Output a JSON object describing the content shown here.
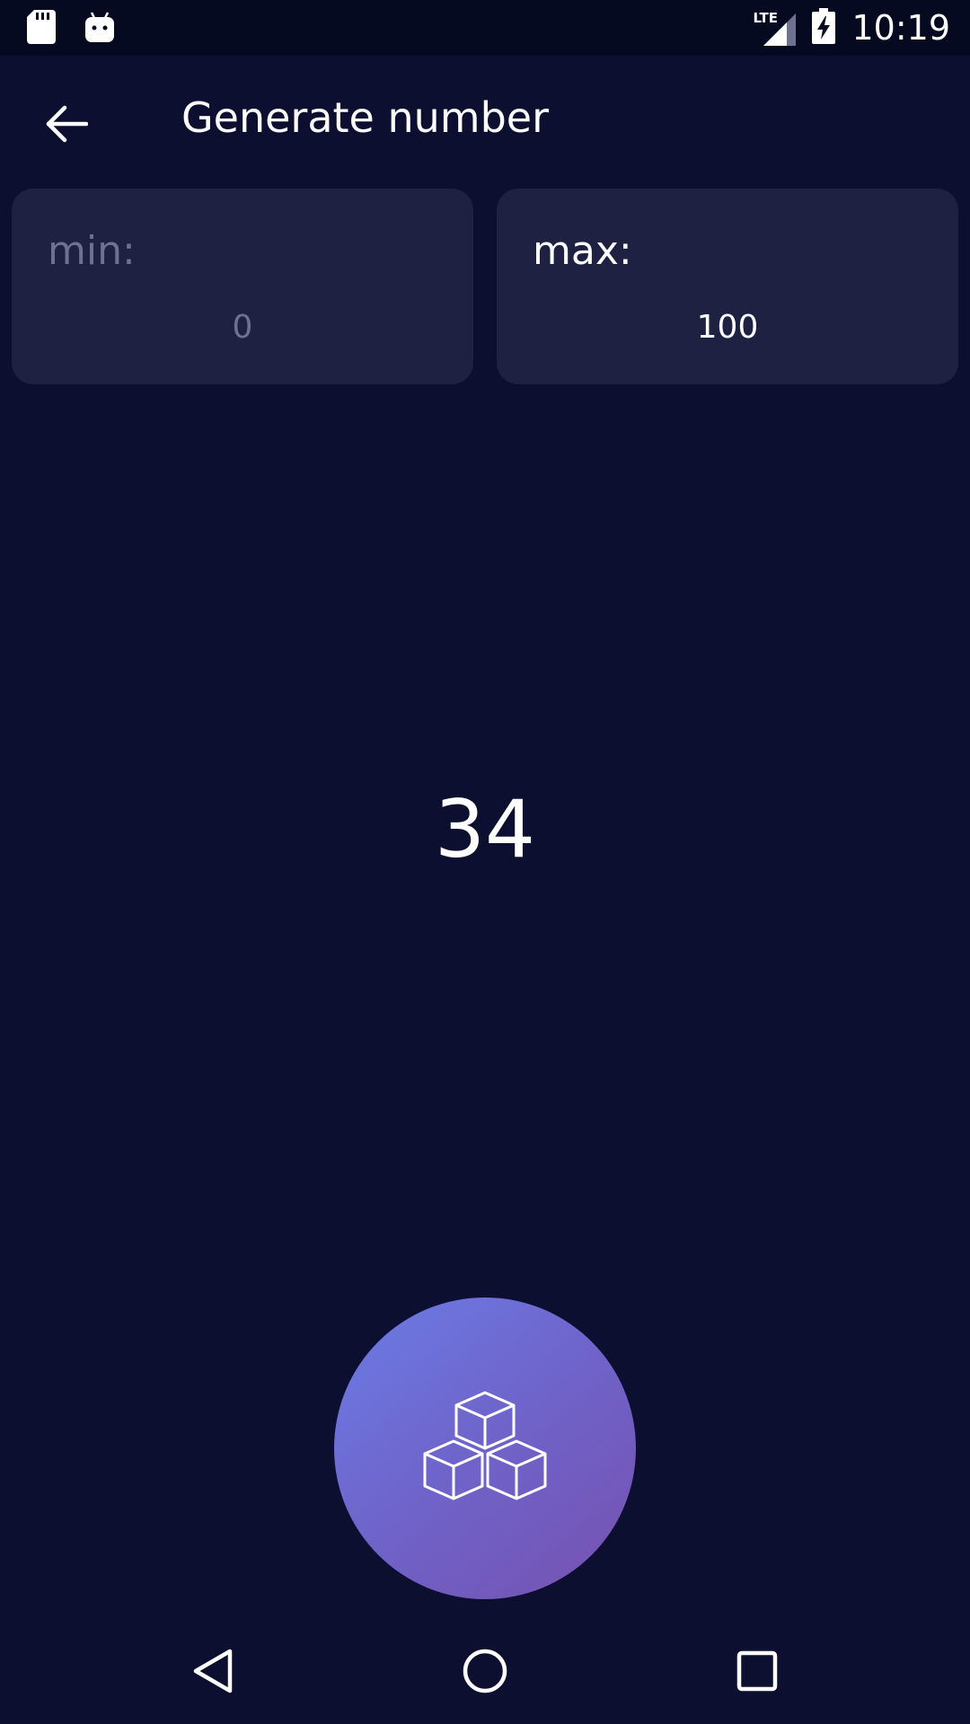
{
  "status_bar": {
    "time": "10:19",
    "network_label": "LTE",
    "icons": [
      "sd-card-icon",
      "android-icon",
      "signal-icon",
      "battery-charging-icon"
    ]
  },
  "app_bar": {
    "title": "Generate number",
    "back_icon": "arrow-back-icon"
  },
  "range": {
    "min": {
      "label": "min:",
      "value": "",
      "placeholder": "0"
    },
    "max": {
      "label": "max:",
      "value": "100",
      "placeholder": ""
    }
  },
  "result": {
    "value": "34"
  },
  "generate_button": {
    "icon": "cubes-icon",
    "gradient": [
      "#6b7ce6",
      "#7651b0"
    ]
  },
  "colors": {
    "background": "#0c0f2f",
    "card": "#1e2142",
    "muted_text": "#6f7190",
    "text": "#ffffff"
  },
  "nav_bar": {
    "icons": [
      "nav-back-icon",
      "nav-home-icon",
      "nav-recents-icon"
    ]
  }
}
